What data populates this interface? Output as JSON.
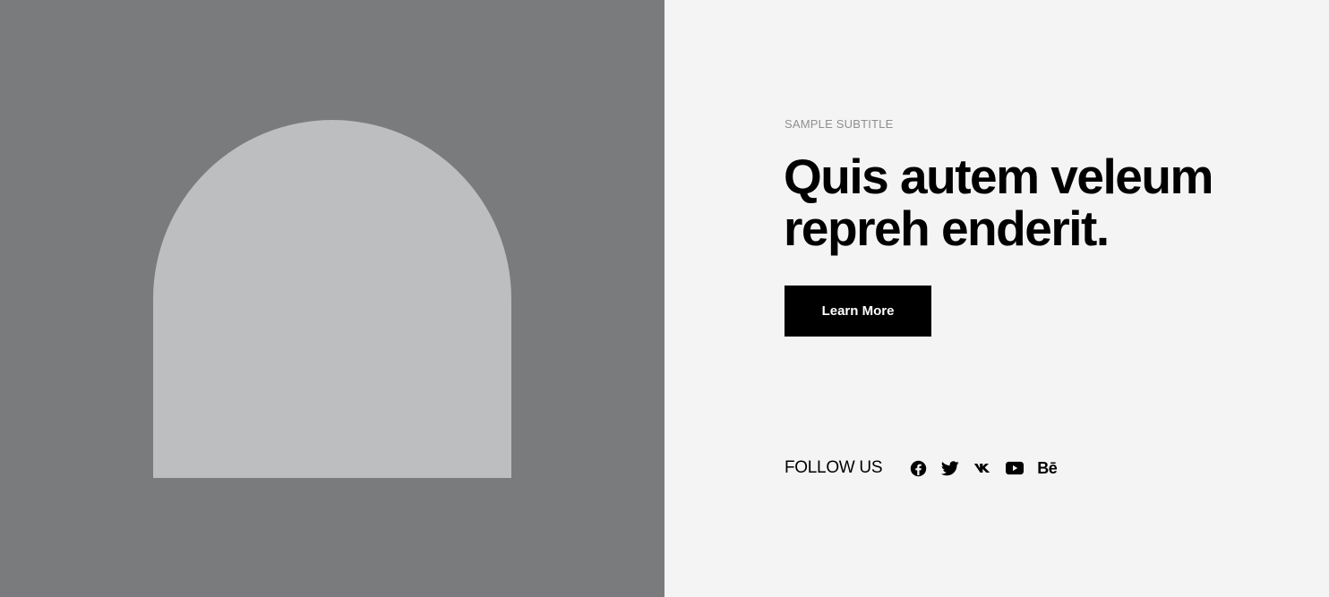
{
  "hero": {
    "subtitle": "SAMPLE SUBTITLE",
    "headline": "Quis autem veleum repreh enderit.",
    "cta_label": "Learn More"
  },
  "follow": {
    "label": "FOLLOW US",
    "icons": [
      "facebook-icon",
      "twitter-icon",
      "vk-icon",
      "youtube-icon",
      "behance-icon"
    ],
    "behance_text": "Bē"
  },
  "colors": {
    "left_panel_bg": "#7a7b7d",
    "arch_fill": "#bdbec0",
    "right_panel_bg": "#f4f4f4",
    "button_bg": "#000000",
    "button_text": "#ffffff",
    "subtitle_text": "#8f8f8f"
  }
}
